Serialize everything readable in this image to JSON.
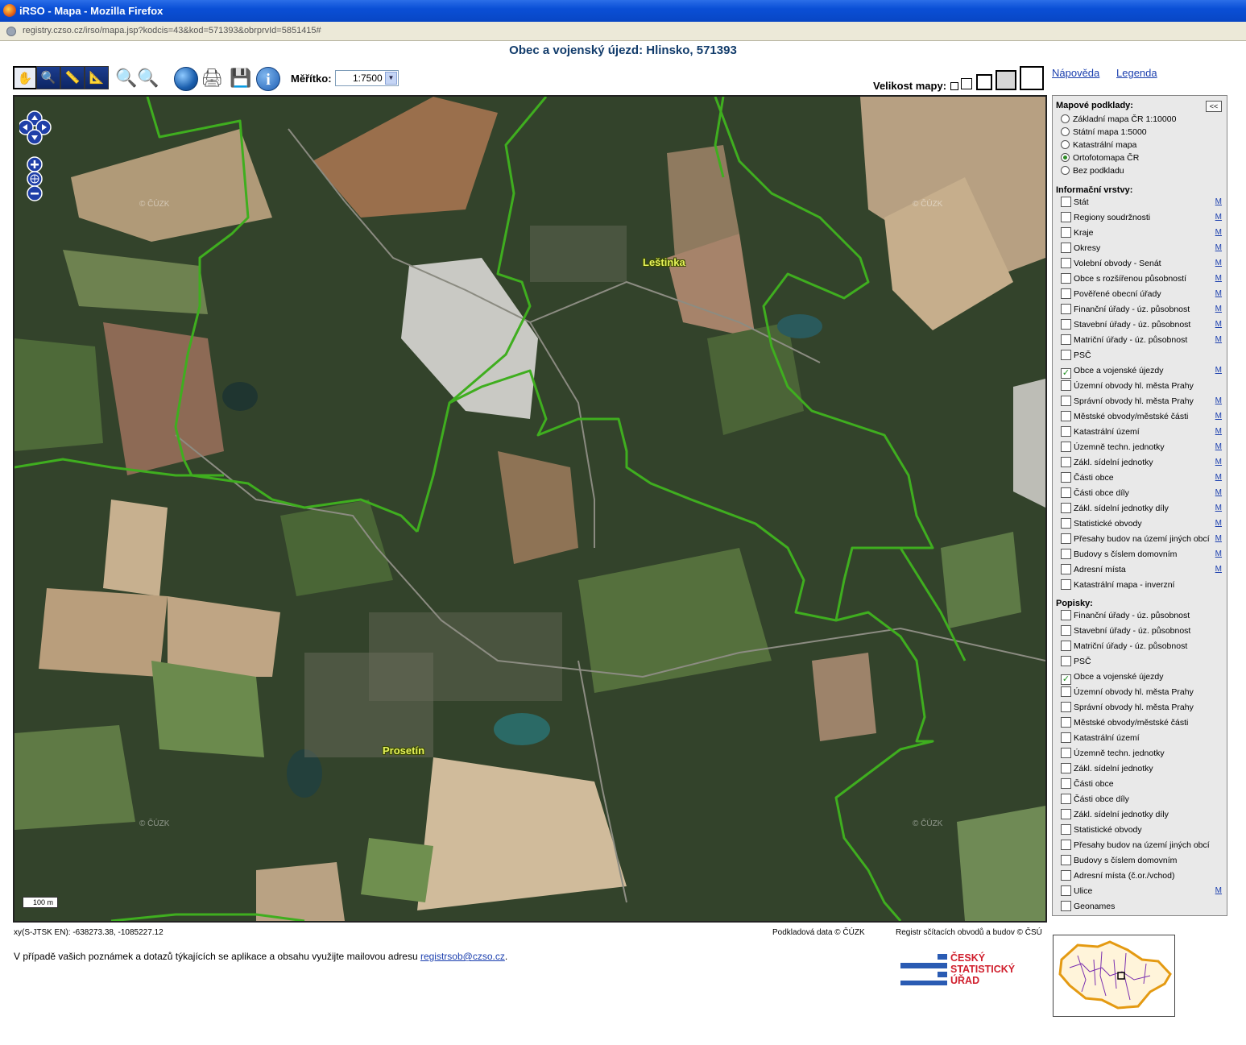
{
  "window": {
    "title": "iRSO - Mapa - Mozilla Firefox",
    "url": "registry.czso.cz/irso/mapa.jsp?kodcis=43&kod=571393&obrprvId=5851415#"
  },
  "page": {
    "title": "Obec a vojenský újezd: Hlinsko, 571393"
  },
  "toolbar": {
    "scale_label": "Měřítko:",
    "scale_value": "1:7500",
    "map_size_label": "Velikost mapy:",
    "help_link": "Nápověda",
    "legend_link": "Legenda"
  },
  "map": {
    "labels": {
      "lestinka": "Leštinka",
      "prosetin": "Prosetín"
    },
    "watermark": "© ČÚZK",
    "scalebar": "100 m"
  },
  "panel": {
    "collapse_label": "<<",
    "basemaps_heading": "Mapové podklady:",
    "basemaps": [
      {
        "label": "Základní mapa ČR 1:10000",
        "selected": false
      },
      {
        "label": "Státní mapa 1:5000",
        "selected": false
      },
      {
        "label": "Katastrální mapa",
        "selected": false
      },
      {
        "label": "Ortofotomapa ČR",
        "selected": true
      },
      {
        "label": "Bez podkladu",
        "selected": false
      }
    ],
    "layers_heading": "Informační vrstvy:",
    "layers": [
      {
        "label": "Stát",
        "checked": false,
        "m": "M"
      },
      {
        "label": "Regiony soudržnosti",
        "checked": false,
        "m": "M"
      },
      {
        "label": "Kraje",
        "checked": false,
        "m": "M"
      },
      {
        "label": "Okresy",
        "checked": false,
        "m": "M"
      },
      {
        "label": "Volební obvody - Senát",
        "checked": false,
        "m": "M"
      },
      {
        "label": "Obce s rozšířenou působností",
        "checked": false,
        "m": "M"
      },
      {
        "label": "Pověřené obecní úřady",
        "checked": false,
        "m": "M"
      },
      {
        "label": "Finanční úřady - úz. působnost",
        "checked": false,
        "m": "M"
      },
      {
        "label": "Stavební úřady - úz. působnost",
        "checked": false,
        "m": "M"
      },
      {
        "label": "Matriční úřady - úz. působnost",
        "checked": false,
        "m": "M"
      },
      {
        "label": "PSČ",
        "checked": false,
        "m": ""
      },
      {
        "label": "Obce a vojenské újezdy",
        "checked": true,
        "m": "M"
      },
      {
        "label": "Územní obvody hl. města Prahy",
        "checked": false,
        "m": ""
      },
      {
        "label": "Správní obvody hl. města Prahy",
        "checked": false,
        "m": "M"
      },
      {
        "label": "Městské obvody/městské části",
        "checked": false,
        "m": "M"
      },
      {
        "label": "Katastrální území",
        "checked": false,
        "m": "M"
      },
      {
        "label": "Územně techn. jednotky",
        "checked": false,
        "m": "M"
      },
      {
        "label": "Zákl. sídelní jednotky",
        "checked": false,
        "m": "M"
      },
      {
        "label": "Části obce",
        "checked": false,
        "m": "M"
      },
      {
        "label": "Části obce díly",
        "checked": false,
        "m": "M"
      },
      {
        "label": "Zákl. sídelní jednotky díly",
        "checked": false,
        "m": "M"
      },
      {
        "label": "Statistické obvody",
        "checked": false,
        "m": "M"
      },
      {
        "label": "Přesahy budov na území jiných obcí",
        "checked": false,
        "m": "M"
      },
      {
        "label": "Budovy s číslem domovním",
        "checked": false,
        "m": "M"
      },
      {
        "label": "Adresní místa",
        "checked": false,
        "m": "M"
      },
      {
        "label": "Katastrální mapa - inverzní",
        "checked": false,
        "m": ""
      }
    ],
    "labels_heading": "Popisky:",
    "label_layers": [
      {
        "label": "Finanční úřady - úz. působnost",
        "checked": false,
        "m": ""
      },
      {
        "label": "Stavební úřady - úz. působnost",
        "checked": false,
        "m": ""
      },
      {
        "label": "Matriční úřady - úz. působnost",
        "checked": false,
        "m": ""
      },
      {
        "label": "PSČ",
        "checked": false,
        "m": ""
      },
      {
        "label": "Obce a vojenské újezdy",
        "checked": true,
        "m": ""
      },
      {
        "label": "Územní obvody hl. města Prahy",
        "checked": false,
        "m": ""
      },
      {
        "label": "Správní obvody hl. města Prahy",
        "checked": false,
        "m": ""
      },
      {
        "label": "Městské obvody/městské části",
        "checked": false,
        "m": ""
      },
      {
        "label": "Katastrální území",
        "checked": false,
        "m": ""
      },
      {
        "label": "Územně techn. jednotky",
        "checked": false,
        "m": ""
      },
      {
        "label": "Zákl. sídelní jednotky",
        "checked": false,
        "m": ""
      },
      {
        "label": "Části obce",
        "checked": false,
        "m": ""
      },
      {
        "label": "Části obce díly",
        "checked": false,
        "m": ""
      },
      {
        "label": "Zákl. sídelní jednotky díly",
        "checked": false,
        "m": ""
      },
      {
        "label": "Statistické obvody",
        "checked": false,
        "m": ""
      },
      {
        "label": "Přesahy budov na území jiných obcí",
        "checked": false,
        "m": ""
      },
      {
        "label": "Budovy s číslem domovním",
        "checked": false,
        "m": ""
      },
      {
        "label": "Adresní místa (č.or./vchod)",
        "checked": false,
        "m": ""
      },
      {
        "label": "Ulice",
        "checked": false,
        "m": "M"
      },
      {
        "label": "Geonames",
        "checked": false,
        "m": ""
      }
    ]
  },
  "footer": {
    "coords": "xy(S-JTSK EN):  -638273.38, -1085227.12",
    "credit_cuzk": "Podkladová data © ČÚZK",
    "credit_csu": "Registr sčítacích obvodů a budov © ČSÚ",
    "note_text": "V případě vašich poznámek a dotazů týkajících se aplikace a obsahu využijte mailovou adresu ",
    "note_email": "registrsob@czso.cz",
    "note_end": ".",
    "logo_lines": [
      "ČESKÝ",
      "STATISTICKÝ",
      "ÚŘAD"
    ]
  },
  "colors": {
    "boundary": "#3fae1f",
    "label": "#e6f25a",
    "link": "#1b3fae",
    "logo_red": "#d01e2c",
    "logo_blue": "#2a5bb3"
  }
}
